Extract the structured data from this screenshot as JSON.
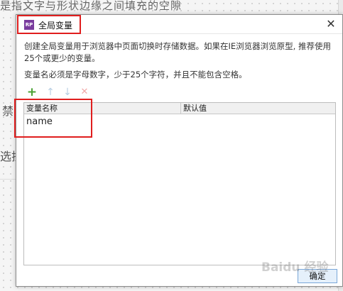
{
  "background": {
    "top_text": "是指文字与形状边缘之间填充的空隙",
    "left_text_a": "禁",
    "left_text_b": "选拉"
  },
  "dialog": {
    "icon_text": "RP",
    "title": "全局变量",
    "close_glyph": "✕",
    "description": "创建全局变量用于浏览器中页面切换时存储数据。如果在IE浏览器浏览原型, 推荐使用25个或更少的变量。",
    "rule": "变量名必须是字母数字，少于25个字符，并且不能包含空格。",
    "toolbar": {
      "add": "+",
      "up": "↑",
      "down": "↓",
      "delete": "✕"
    },
    "table": {
      "columns": [
        "变量名称",
        "默认值"
      ],
      "rows": [
        {
          "name": "name",
          "default": ""
        }
      ]
    },
    "ok_label": "确定"
  },
  "watermark": "Baidu 经验"
}
